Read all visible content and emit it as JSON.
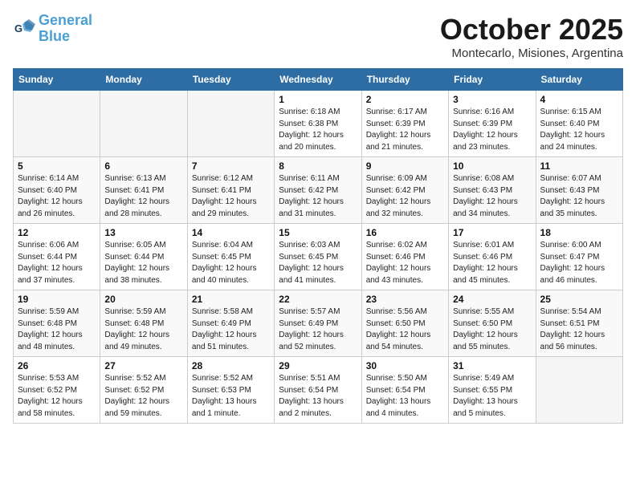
{
  "header": {
    "logo_line1": "General",
    "logo_line2": "Blue",
    "month": "October 2025",
    "location": "Montecarlo, Misiones, Argentina"
  },
  "weekdays": [
    "Sunday",
    "Monday",
    "Tuesday",
    "Wednesday",
    "Thursday",
    "Friday",
    "Saturday"
  ],
  "weeks": [
    [
      {
        "day": "",
        "info": ""
      },
      {
        "day": "",
        "info": ""
      },
      {
        "day": "",
        "info": ""
      },
      {
        "day": "1",
        "info": "Sunrise: 6:18 AM\nSunset: 6:38 PM\nDaylight: 12 hours\nand 20 minutes."
      },
      {
        "day": "2",
        "info": "Sunrise: 6:17 AM\nSunset: 6:39 PM\nDaylight: 12 hours\nand 21 minutes."
      },
      {
        "day": "3",
        "info": "Sunrise: 6:16 AM\nSunset: 6:39 PM\nDaylight: 12 hours\nand 23 minutes."
      },
      {
        "day": "4",
        "info": "Sunrise: 6:15 AM\nSunset: 6:40 PM\nDaylight: 12 hours\nand 24 minutes."
      }
    ],
    [
      {
        "day": "5",
        "info": "Sunrise: 6:14 AM\nSunset: 6:40 PM\nDaylight: 12 hours\nand 26 minutes."
      },
      {
        "day": "6",
        "info": "Sunrise: 6:13 AM\nSunset: 6:41 PM\nDaylight: 12 hours\nand 28 minutes."
      },
      {
        "day": "7",
        "info": "Sunrise: 6:12 AM\nSunset: 6:41 PM\nDaylight: 12 hours\nand 29 minutes."
      },
      {
        "day": "8",
        "info": "Sunrise: 6:11 AM\nSunset: 6:42 PM\nDaylight: 12 hours\nand 31 minutes."
      },
      {
        "day": "9",
        "info": "Sunrise: 6:09 AM\nSunset: 6:42 PM\nDaylight: 12 hours\nand 32 minutes."
      },
      {
        "day": "10",
        "info": "Sunrise: 6:08 AM\nSunset: 6:43 PM\nDaylight: 12 hours\nand 34 minutes."
      },
      {
        "day": "11",
        "info": "Sunrise: 6:07 AM\nSunset: 6:43 PM\nDaylight: 12 hours\nand 35 minutes."
      }
    ],
    [
      {
        "day": "12",
        "info": "Sunrise: 6:06 AM\nSunset: 6:44 PM\nDaylight: 12 hours\nand 37 minutes."
      },
      {
        "day": "13",
        "info": "Sunrise: 6:05 AM\nSunset: 6:44 PM\nDaylight: 12 hours\nand 38 minutes."
      },
      {
        "day": "14",
        "info": "Sunrise: 6:04 AM\nSunset: 6:45 PM\nDaylight: 12 hours\nand 40 minutes."
      },
      {
        "day": "15",
        "info": "Sunrise: 6:03 AM\nSunset: 6:45 PM\nDaylight: 12 hours\nand 41 minutes."
      },
      {
        "day": "16",
        "info": "Sunrise: 6:02 AM\nSunset: 6:46 PM\nDaylight: 12 hours\nand 43 minutes."
      },
      {
        "day": "17",
        "info": "Sunrise: 6:01 AM\nSunset: 6:46 PM\nDaylight: 12 hours\nand 45 minutes."
      },
      {
        "day": "18",
        "info": "Sunrise: 6:00 AM\nSunset: 6:47 PM\nDaylight: 12 hours\nand 46 minutes."
      }
    ],
    [
      {
        "day": "19",
        "info": "Sunrise: 5:59 AM\nSunset: 6:48 PM\nDaylight: 12 hours\nand 48 minutes."
      },
      {
        "day": "20",
        "info": "Sunrise: 5:59 AM\nSunset: 6:48 PM\nDaylight: 12 hours\nand 49 minutes."
      },
      {
        "day": "21",
        "info": "Sunrise: 5:58 AM\nSunset: 6:49 PM\nDaylight: 12 hours\nand 51 minutes."
      },
      {
        "day": "22",
        "info": "Sunrise: 5:57 AM\nSunset: 6:49 PM\nDaylight: 12 hours\nand 52 minutes."
      },
      {
        "day": "23",
        "info": "Sunrise: 5:56 AM\nSunset: 6:50 PM\nDaylight: 12 hours\nand 54 minutes."
      },
      {
        "day": "24",
        "info": "Sunrise: 5:55 AM\nSunset: 6:50 PM\nDaylight: 12 hours\nand 55 minutes."
      },
      {
        "day": "25",
        "info": "Sunrise: 5:54 AM\nSunset: 6:51 PM\nDaylight: 12 hours\nand 56 minutes."
      }
    ],
    [
      {
        "day": "26",
        "info": "Sunrise: 5:53 AM\nSunset: 6:52 PM\nDaylight: 12 hours\nand 58 minutes."
      },
      {
        "day": "27",
        "info": "Sunrise: 5:52 AM\nSunset: 6:52 PM\nDaylight: 12 hours\nand 59 minutes."
      },
      {
        "day": "28",
        "info": "Sunrise: 5:52 AM\nSunset: 6:53 PM\nDaylight: 13 hours\nand 1 minute."
      },
      {
        "day": "29",
        "info": "Sunrise: 5:51 AM\nSunset: 6:54 PM\nDaylight: 13 hours\nand 2 minutes."
      },
      {
        "day": "30",
        "info": "Sunrise: 5:50 AM\nSunset: 6:54 PM\nDaylight: 13 hours\nand 4 minutes."
      },
      {
        "day": "31",
        "info": "Sunrise: 5:49 AM\nSunset: 6:55 PM\nDaylight: 13 hours\nand 5 minutes."
      },
      {
        "day": "",
        "info": ""
      }
    ]
  ]
}
